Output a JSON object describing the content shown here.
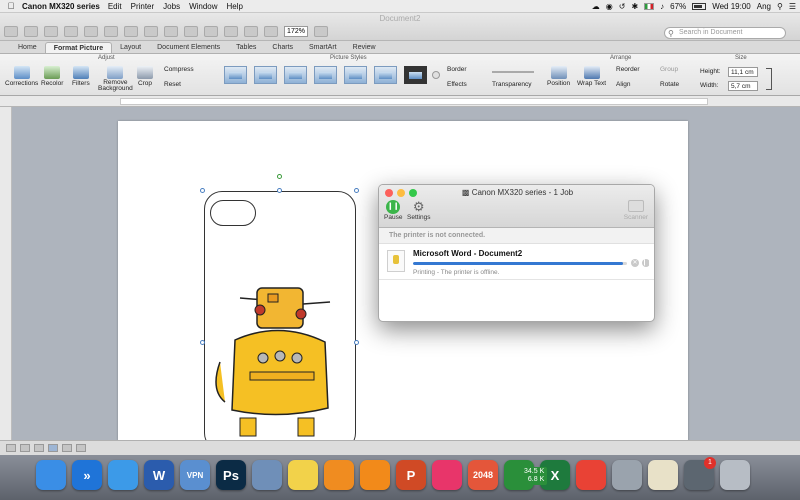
{
  "menubar": {
    "apple": "",
    "app_name": "Canon MX320 series",
    "items": [
      "Edit",
      "Printer",
      "Jobs",
      "Window",
      "Help"
    ],
    "battery": "67%",
    "clock": "Wed 19:00",
    "user": "Ang"
  },
  "window": {
    "doc_title": "Document2",
    "zoom": "172%",
    "search_placeholder": "Search in Document"
  },
  "tabs": [
    "Home",
    "Format Picture",
    "Layout",
    "Document Elements",
    "Tables",
    "Charts",
    "SmartArt",
    "Review"
  ],
  "ribbon": {
    "groups": {
      "adjust": "Adjust",
      "picture_styles": "Picture Styles",
      "arrange": "Arrange",
      "size": "Size"
    },
    "buttons": {
      "corrections": "Corrections",
      "recolor": "Recolor",
      "filters": "Filters",
      "remove_background_1": "Remove",
      "remove_background_2": "Background",
      "crop": "Crop",
      "compress": "Compress",
      "reset": "Reset",
      "border": "Border",
      "effects": "Effects",
      "transparency": "Transparency",
      "position": "Position",
      "wrap_text": "Wrap Text",
      "reorder": "Reorder",
      "align": "Align",
      "group": "Group",
      "rotate": "Rotate"
    },
    "size": {
      "height_label": "Height:",
      "height_value": "11,1 cm",
      "width_label": "Width:",
      "width_value": "5,7 cm"
    }
  },
  "print_queue": {
    "title": "Canon MX320 series - 1 Job",
    "pause": "Pause",
    "settings": "Settings",
    "scanner": "Scanner",
    "banner": "The printer is not connected.",
    "job": {
      "name": "Microsoft Word - Document2",
      "status": "Printing - The printer is offline.",
      "progress": 0.98
    }
  },
  "dock": {
    "items": [
      {
        "name": "finder",
        "label": "",
        "color": "#3a8ee6"
      },
      {
        "name": "jumpdesktop",
        "label": "»",
        "color": "#1f74d8"
      },
      {
        "name": "safari",
        "label": "",
        "color": "#3c9ae8"
      },
      {
        "name": "word",
        "label": "W",
        "color": "#2b5cad"
      },
      {
        "name": "vpn",
        "label": "VPN",
        "color": "#5a8fd0"
      },
      {
        "name": "photoshop",
        "label": "Ps",
        "color": "#0b2b45"
      },
      {
        "name": "preview",
        "label": "",
        "color": "#6f8fb8"
      },
      {
        "name": "notes",
        "label": "",
        "color": "#f2d24a"
      },
      {
        "name": "ibooks",
        "label": "",
        "color": "#f08c20"
      },
      {
        "name": "vlc",
        "label": "",
        "color": "#f28a1a"
      },
      {
        "name": "powerpoint",
        "label": "P",
        "color": "#d04a25"
      },
      {
        "name": "itunes",
        "label": "",
        "color": "#e8356a"
      },
      {
        "name": "game-2048",
        "label": "2048",
        "color": "#e4563a"
      },
      {
        "name": "netmonitor",
        "label": "",
        "color": "#2a8f3a"
      },
      {
        "name": "excel",
        "label": "X",
        "color": "#1e7a3d"
      },
      {
        "name": "chrome",
        "label": "",
        "color": "#e94235"
      },
      {
        "name": "launchpad",
        "label": "",
        "color": "#9aa3ad"
      },
      {
        "name": "scanner-app",
        "label": "",
        "color": "#e8e1c8"
      },
      {
        "name": "printer",
        "label": "",
        "color": "#5c6670"
      },
      {
        "name": "trash",
        "label": "",
        "color": "#b7bdc5"
      }
    ],
    "net_up": "34.5 K",
    "net_down": "6.8 K",
    "printer_badge": "1"
  }
}
